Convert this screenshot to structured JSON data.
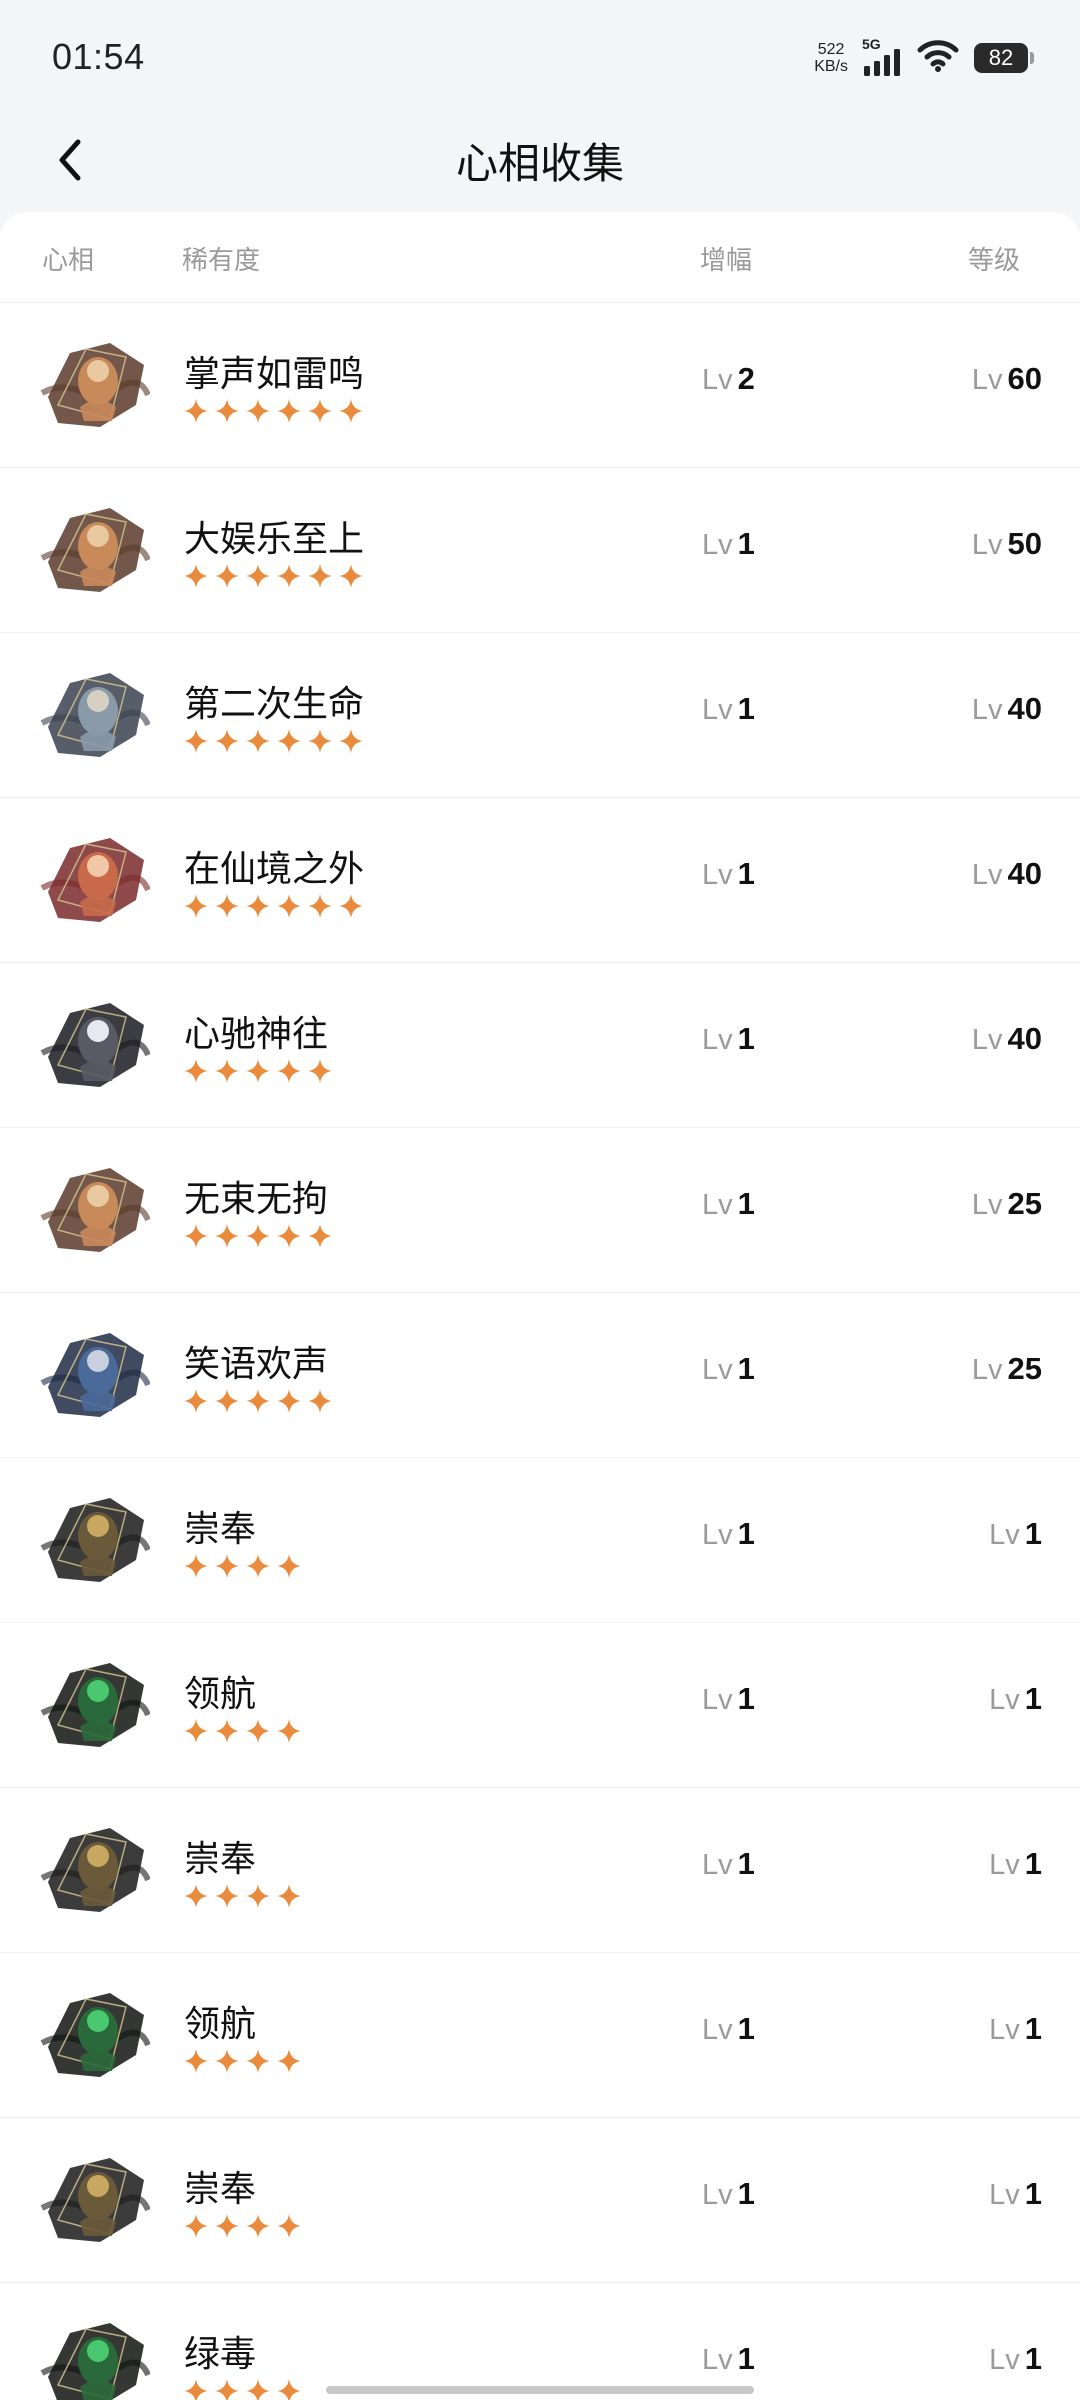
{
  "status_bar": {
    "time": "01:54",
    "net_speed_value": "522",
    "net_speed_unit": "KB/s",
    "network_type": "5G",
    "battery_level": "82"
  },
  "nav": {
    "title": "心相收集"
  },
  "table": {
    "headers": {
      "avatar": "心相",
      "rarity": "稀有度",
      "boost": "增幅",
      "level": "等级"
    },
    "lv_prefix": "Lv",
    "star_color": "#e98a3c",
    "rows": [
      {
        "name": "掌声如雷鸣",
        "stars": 6,
        "boost": "2",
        "level": "60",
        "art": "warm"
      },
      {
        "name": "大娱乐至上",
        "stars": 6,
        "boost": "1",
        "level": "50",
        "art": "warm"
      },
      {
        "name": "第二次生命",
        "stars": 6,
        "boost": "1",
        "level": "40",
        "art": "cool"
      },
      {
        "name": "在仙境之外",
        "stars": 6,
        "boost": "1",
        "level": "40",
        "art": "red"
      },
      {
        "name": "心驰神往",
        "stars": 5,
        "boost": "1",
        "level": "40",
        "art": "dark"
      },
      {
        "name": "无束无拘",
        "stars": 5,
        "boost": "1",
        "level": "25",
        "art": "warm"
      },
      {
        "name": "笑语欢声",
        "stars": 5,
        "boost": "1",
        "level": "25",
        "art": "blue"
      },
      {
        "name": "崇奉",
        "stars": 4,
        "boost": "1",
        "level": "1",
        "art": "gold"
      },
      {
        "name": "领航",
        "stars": 4,
        "boost": "1",
        "level": "1",
        "art": "green"
      },
      {
        "name": "崇奉",
        "stars": 4,
        "boost": "1",
        "level": "1",
        "art": "gold"
      },
      {
        "name": "领航",
        "stars": 4,
        "boost": "1",
        "level": "1",
        "art": "green"
      },
      {
        "name": "崇奉",
        "stars": 4,
        "boost": "1",
        "level": "1",
        "art": "gold"
      },
      {
        "name": "绿毒",
        "stars": 4,
        "boost": "1",
        "level": "1",
        "art": "green"
      }
    ]
  }
}
